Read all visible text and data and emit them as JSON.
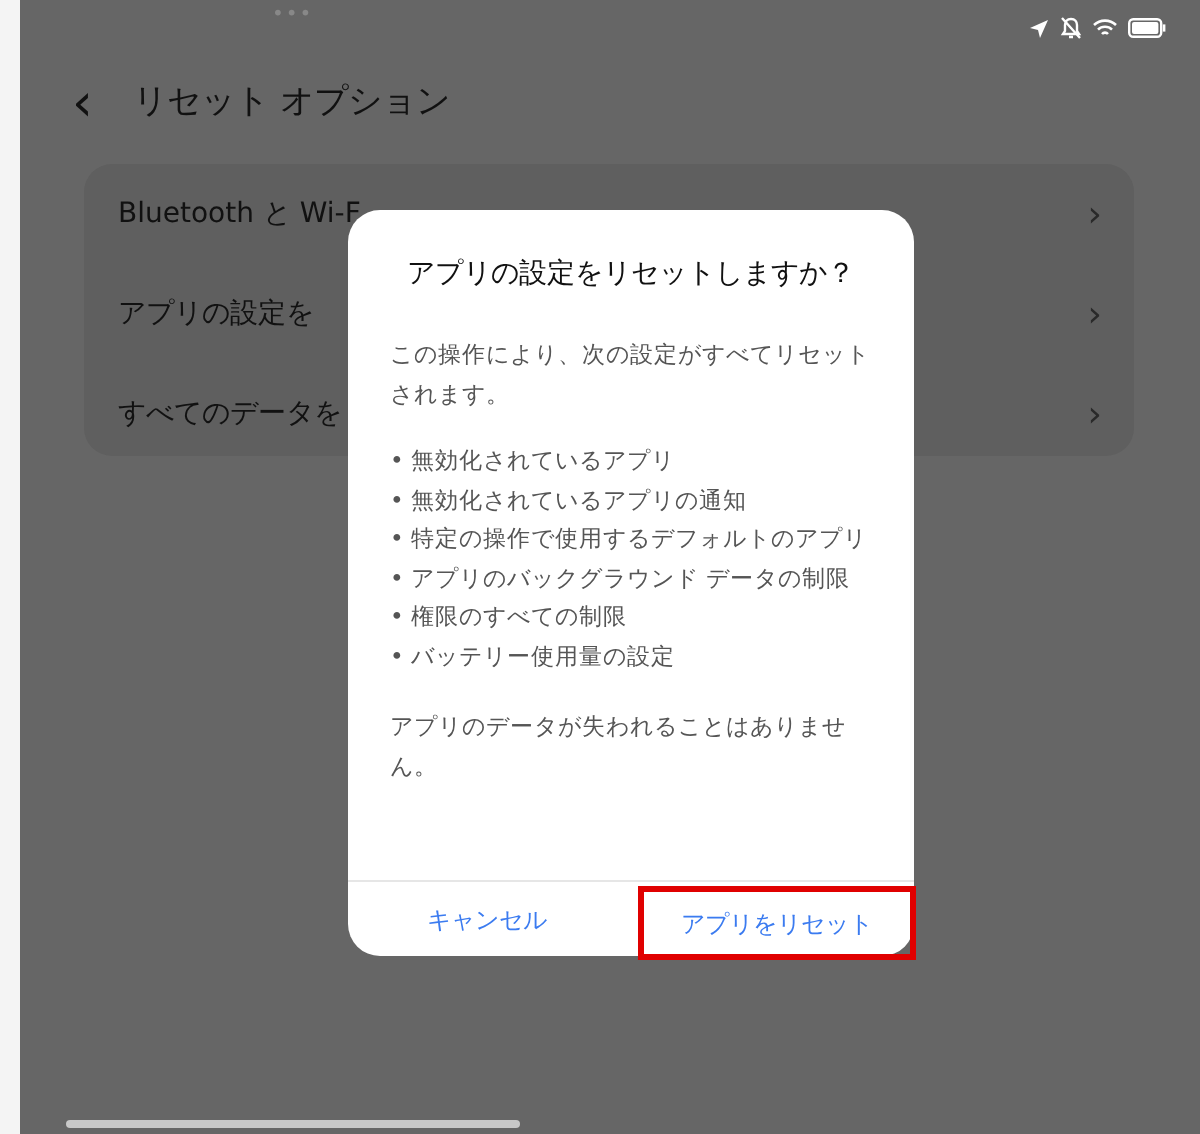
{
  "status_bar": {
    "dots": "•••"
  },
  "header": {
    "back": "‹",
    "title": "リセット オプション"
  },
  "options": [
    {
      "label": "Bluetooth と Wi-F",
      "chevron": "›"
    },
    {
      "label": "アプリの設定を",
      "chevron": "›"
    },
    {
      "label": "すべてのデータを",
      "chevron": "›"
    }
  ],
  "dialog": {
    "title": "アプリの設定をリセットしますか？",
    "intro": "この操作により、次の設定がすべてリセットされます。",
    "bullets": [
      "• 無効化されているアプリ",
      "• 無効化されているアプリの通知",
      "• 特定の操作で使用するデフォルトのアプリ",
      "• アプリのバックグラウンド データの制限",
      "• 権限のすべての制限",
      "• バッテリー使用量の設定"
    ],
    "note": "アプリのデータが失われることはありません。",
    "buttons": [
      {
        "label": "キャンセル",
        "highlighted": false
      },
      {
        "label": "アプリをリセット",
        "highlighted": true
      }
    ]
  }
}
